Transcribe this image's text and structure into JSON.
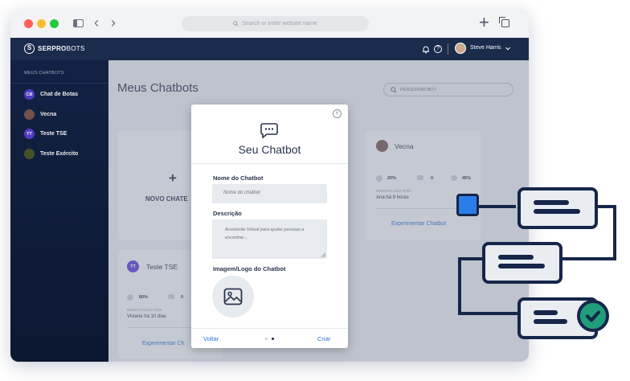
{
  "browser": {
    "url_placeholder": "Search or enter website name",
    "plus_icon": "+",
    "back_icon": "‹",
    "forward_icon": "›"
  },
  "header": {
    "logo_bold": "SERPRO",
    "logo_light": "BOTS",
    "user_name": "Steve Harris"
  },
  "sidebar": {
    "section_title": "MEUS CHATBOTS",
    "items": [
      {
        "initials": "CB",
        "label": "Chat de Botas",
        "color": "#5b3fd6"
      },
      {
        "initials": "",
        "label": "Vecna",
        "color": "#7a5a52"
      },
      {
        "initials": "TT",
        "label": "Teste TSE",
        "color": "#5b3fd6"
      },
      {
        "initials": "",
        "label": "Teste Exército",
        "color": "#4d5a2a"
      }
    ]
  },
  "main": {
    "title": "Meus Chatbots",
    "search_placeholder": "PESQUISAR BOT",
    "new_chatbot": {
      "plus": "+",
      "label": "NOVO CHATE"
    },
    "cards": [
      {
        "name": "Vecna",
        "stat1": "20%",
        "stat2": "0",
        "stat3": "45%",
        "modified_label": "MODIFICADO POR",
        "modified_by": "Ana há 9 horas",
        "cta": "Experimentar Chatbot"
      },
      {
        "initials": "TT",
        "name": "Teste TSE",
        "stat1": "80%",
        "stat2": "0",
        "modified_label": "MODIFICADO POR",
        "modified_by": "Viviane há 10 dias",
        "cta": "Experimentar Ch"
      }
    ]
  },
  "modal": {
    "title": "Seu Chatbot",
    "close_icon": "×",
    "name_label": "Nome do Chatbot",
    "name_placeholder": "Nome do chatbot",
    "desc_label": "Descrição",
    "desc_placeholder": "Assistente Virtual para ajudar pessoas a encontrar...",
    "image_label": "Imagem/Logo do Chatbot",
    "back_label": "Voltar",
    "create_label": "Criar"
  },
  "colors": {
    "navy": "#16264a",
    "accent": "#2b7de9",
    "check": "#1f9e7a"
  }
}
